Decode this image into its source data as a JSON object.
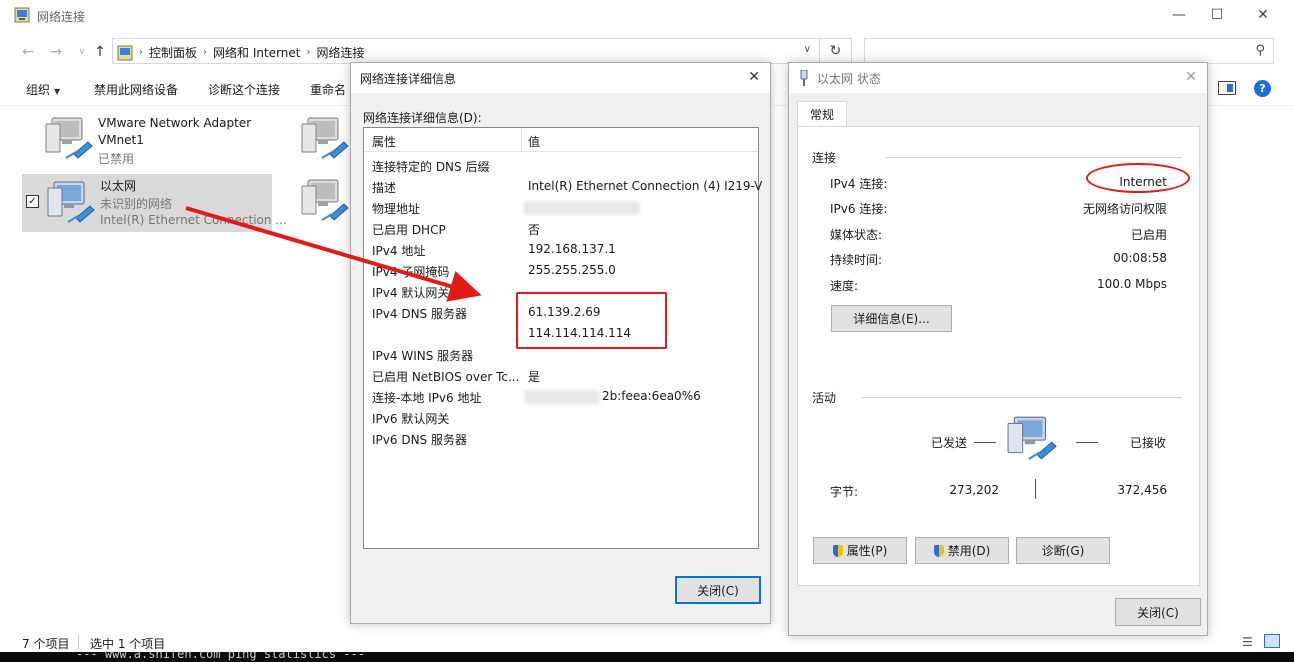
{
  "explorer": {
    "title": "网络连接",
    "breadcrumbs": [
      "控制面板",
      "网络和 Internet",
      "网络连接"
    ],
    "search_placeholder": "",
    "toolbar": {
      "organize": "组织",
      "disable_device": "禁用此网络设备",
      "diagnose": "诊断这个连接",
      "rename": "重命名"
    },
    "items": [
      {
        "name": "VMware Network Adapter VMnet1",
        "line1": "VMware Network Adapter",
        "line1b": "VMnet1",
        "status": "已禁用"
      },
      {
        "name": "以太网",
        "line1": "以太网",
        "status": "未识别的网络",
        "device": "Intel(R) Ethernet Connection ..."
      }
    ],
    "statusbar": {
      "count": "7 个项目",
      "selected": "选中 1 个项目"
    },
    "terminal_text": "--- www.a.shifen.com ping statistics ---"
  },
  "details": {
    "title": "网络连接详细信息",
    "list_label": "网络连接详细信息(D):",
    "col_property": "属性",
    "col_value": "值",
    "rows": [
      {
        "p": "连接特定的 DNS 后缀",
        "v": ""
      },
      {
        "p": "描述",
        "v": "Intel(R) Ethernet Connection (4) I219-V"
      },
      {
        "p": "物理地址",
        "v": ""
      },
      {
        "p": "已启用 DHCP",
        "v": "否"
      },
      {
        "p": "IPv4 地址",
        "v": "192.168.137.1"
      },
      {
        "p": "IPv4 子网掩码",
        "v": "255.255.255.0"
      },
      {
        "p": "IPv4 默认网关",
        "v": ""
      },
      {
        "p": "IPv4 DNS 服务器",
        "v": "61.139.2.69"
      },
      {
        "p": "",
        "v": "114.114.114.114"
      },
      {
        "p": "IPv4 WINS 服务器",
        "v": ""
      },
      {
        "p": "已启用 NetBIOS over Tc...",
        "v": "是"
      },
      {
        "p": "连接-本地 IPv6 地址",
        "v": "2b:feea:6ea0%6"
      },
      {
        "p": "IPv6 默认网关",
        "v": ""
      },
      {
        "p": "IPv6 DNS 服务器",
        "v": ""
      }
    ],
    "close_label": "关闭(C)"
  },
  "status": {
    "title": "以太网 状态",
    "tab_general": "常规",
    "connection_group": "连接",
    "ipv4_label": "IPv4 连接:",
    "ipv4_value": "Internet",
    "ipv6_label": "IPv6 连接:",
    "ipv6_value": "无网络访问权限",
    "media_label": "媒体状态:",
    "media_value": "已启用",
    "duration_label": "持续时间:",
    "duration_value": "00:08:58",
    "speed_label": "速度:",
    "speed_value": "100.0 Mbps",
    "details_button": "详细信息(E)...",
    "activity_group": "活动",
    "sent_label": "已发送",
    "received_label": "已接收",
    "bytes_label": "字节:",
    "bytes_sent": "273,202",
    "bytes_received": "372,456",
    "properties_button": "属性(P)",
    "disable_button": "禁用(D)",
    "diagnose_button": "诊断(G)",
    "close_button": "关闭(C)"
  },
  "colors": {
    "annotation_red": "#e3191a",
    "accent_blue": "#0078d7"
  }
}
